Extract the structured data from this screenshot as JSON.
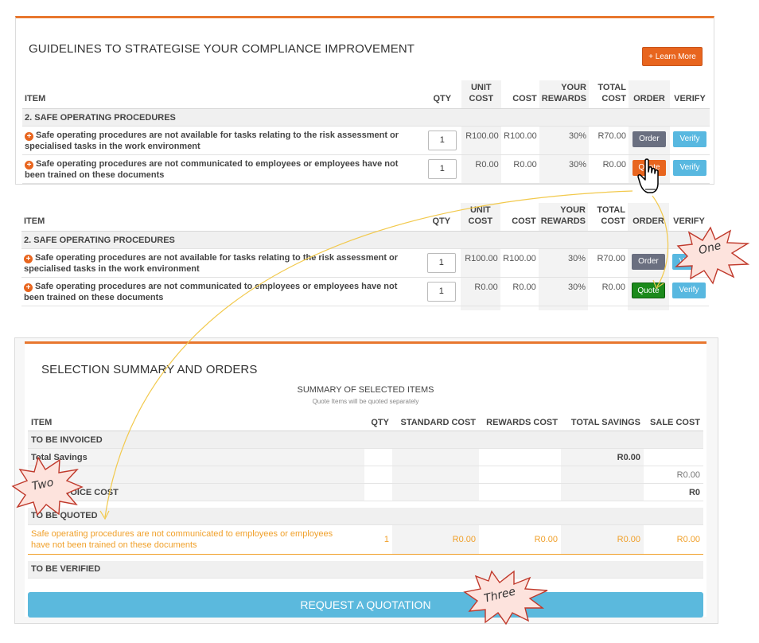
{
  "guidelines": {
    "title": "GUIDELINES TO STRATEGISE YOUR COMPLIANCE IMPROVEMENT",
    "learn_more": "+ Learn More"
  },
  "columns": {
    "item": "ITEM",
    "qty": "QTY",
    "unit_cost_1": "UNIT",
    "unit_cost_2": "COST",
    "cost": "COST",
    "rewards_1": "YOUR",
    "rewards_2": "REWARDS",
    "total_1": "TOTAL",
    "total_2": "COST",
    "order": "ORDER",
    "verify": "VERIFY"
  },
  "section": "2. SAFE OPERATING PROCEDURES",
  "rows": [
    {
      "desc": "Safe operating procedures are not available for tasks relating to the risk assessment or specialised tasks in the work environment",
      "qty": "1",
      "unit_cost": "R100.00",
      "cost": "R100.00",
      "rewards": "30%",
      "total": "R70.00",
      "order": "Order",
      "verify": "Verify"
    },
    {
      "desc": "Safe operating procedures are not communicated to employees or employees have not been trained on these documents",
      "qty": "1",
      "unit_cost": "R0.00",
      "cost": "R0.00",
      "rewards": "30%",
      "total": "R0.00",
      "order": "Quote",
      "verify": "Verify"
    }
  ],
  "summary": {
    "title": "SELECTION SUMMARY AND ORDERS",
    "heading": "SUMMARY OF SELECTED ITEMS",
    "note": "Quote Items will be quoted separately",
    "columns": {
      "item": "ITEM",
      "qty": "QTY",
      "standard": "STANDARD COST",
      "rewards": "REWARDS COST",
      "savings": "TOTAL SAVINGS",
      "sale": "SALE COST"
    },
    "invoiced_label": "TO BE INVOICED",
    "total_savings_label": "Total Savings",
    "total_savings_value": "R0.00",
    "blank_value": "R0.00",
    "invoice_cost_label": "VOICE COST",
    "invoice_cost_value": "R0",
    "quoted_label": "TO BE QUOTED",
    "quoted_item": {
      "desc": "Safe operating procedures are not communicated to employees or employees have not been trained on these documents",
      "qty": "1",
      "standard": "R0.00",
      "rewards": "R0.00",
      "savings": "R0.00",
      "sale": "R0.00"
    },
    "verified_label": "TO BE VERIFIED",
    "request_button": "REQUEST A QUOTATION"
  },
  "callouts": {
    "one": "One",
    "two": "Two",
    "three": "Three"
  },
  "colors": {
    "accent_orange": "#e8651e",
    "order_gray": "#6a6f80",
    "verify_blue": "#58b8e0",
    "quote_green": "#1b8a1b",
    "quoted_text": "#f0a02a",
    "request_blue": "#5bb9dd"
  }
}
